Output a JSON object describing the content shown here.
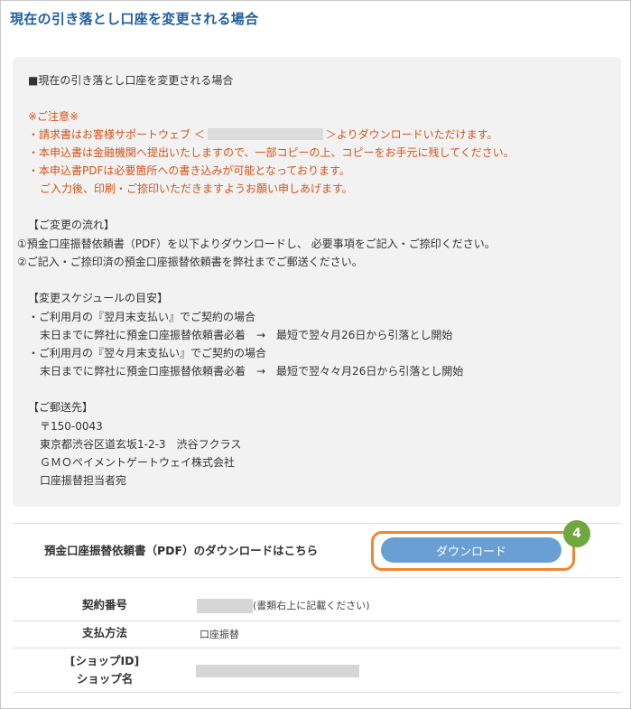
{
  "page": {
    "title": "現在の引き落とし口座を変更される場合"
  },
  "info": {
    "heading": "■現在の引き落とし口座を変更される場合",
    "caution_title": "※ご注意※",
    "caution_1_pre": "・請求書はお客様サポートウェブ ＜",
    "caution_1_post": "＞よりダウンロードいただけます。",
    "caution_2": "・本申込書は金融機関へ提出いたしますので、一部コピーの上、コピーをお手元に残してください。",
    "caution_3": "・本申込書PDFは必要箇所への書き込みが可能となっております。",
    "caution_4": "ご入力後、印刷・ご捺印いただきますようお願い申しあげます。",
    "flow_title": "【ご変更の流れ】",
    "flow_1": "①預金口座振替依頼書（PDF）を以下よりダウンロードし、 必要事項をご記入・ご捺印ください。",
    "flow_2": "②ご記入・ご捺印済の預金口座振替依頼書を弊社までご郵送ください。",
    "schedule_title": "【変更スケジュールの目安】",
    "schedule_1": "・ご利用月の『翌月末支払い』でご契約の場合",
    "schedule_2": "末日までに弊社に預金口座振替依頼書必着　→　最短で翌々月26日から引落とし開始",
    "schedule_3": "・ご利用月の『翌々月末支払い』でご契約の場合",
    "schedule_4": "末日までに弊社に預金口座振替依頼書必着　→　最短で翌々々月26日から引落とし開始",
    "mail_title": "【ご郵送先】",
    "mail_zip": "〒150-0043",
    "mail_address": "東京都渋谷区道玄坂1-2-3　渋谷フクラス",
    "mail_company": "ＧＭＯペイメントゲートウェイ株式会社",
    "mail_dept": "口座振替担当者宛"
  },
  "download": {
    "label": "預金口座振替依頼書（PDF）のダウンロードはこちら",
    "button_label": "ダウンロード",
    "step_badge": "4",
    "highlight_color": "#ee8733",
    "badge_color": "#6ea83f"
  },
  "details": {
    "contract_label": "契約番号",
    "contract_note": "(書類右上に記載ください)",
    "payment_label": "支払方法",
    "payment_value": "口座振替",
    "shop_label_1": "[ショップID]",
    "shop_label_2": "ショップ名"
  },
  "colors": {
    "title": "#1f5fa0",
    "caution": "#d3541a",
    "button": "#6a9fd4"
  }
}
